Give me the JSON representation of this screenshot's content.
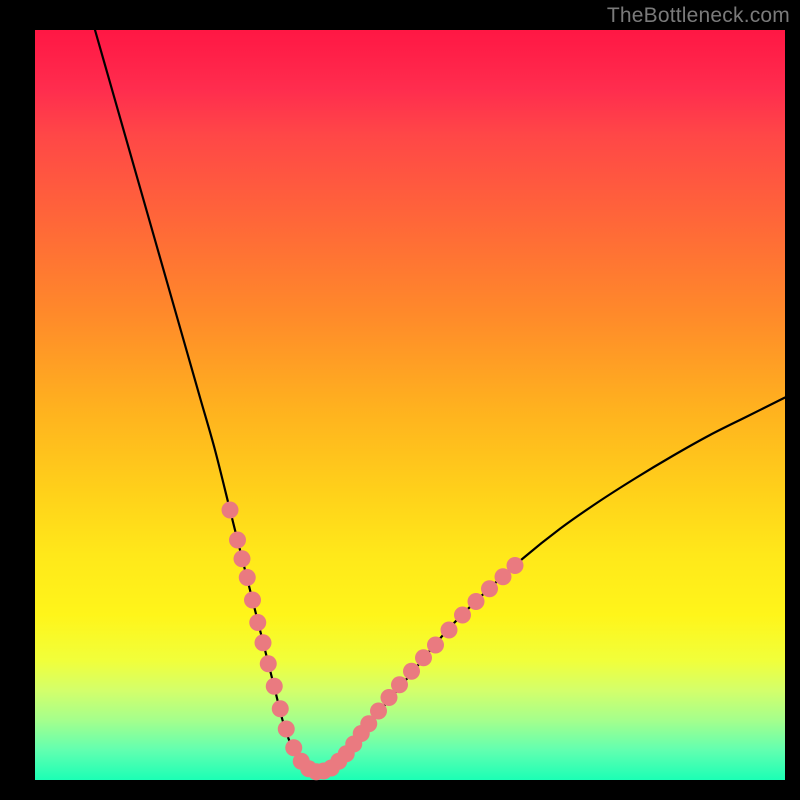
{
  "watermark": "TheBottleneck.com",
  "colors": {
    "background": "#000000",
    "curve": "#000000",
    "dot_fill": "#ea7a80",
    "dot_stroke": "#c45a60",
    "gradient_top": "#ff1744",
    "gradient_bottom": "#1bffb5"
  },
  "chart_data": {
    "type": "line",
    "title": "",
    "xlabel": "",
    "ylabel": "",
    "xlim": [
      0,
      100
    ],
    "ylim": [
      0,
      100
    ],
    "grid": false,
    "legend": false,
    "annotations": [
      "TheBottleneck.com"
    ],
    "series": [
      {
        "name": "bottleneck-curve",
        "x": [
          8,
          10,
          12,
          14,
          16,
          18,
          20,
          22,
          24,
          26,
          27,
          28,
          29,
          30,
          31,
          32,
          33,
          34,
          35,
          36,
          37,
          38,
          39,
          40,
          42,
          45,
          50,
          55,
          60,
          65,
          70,
          75,
          80,
          85,
          90,
          95,
          100
        ],
        "y": [
          100,
          93,
          86,
          79,
          72,
          65,
          58,
          51,
          44,
          36,
          32,
          28,
          24,
          20,
          16,
          12,
          8,
          5,
          3,
          2,
          1.2,
          1,
          1.3,
          2,
          4,
          8,
          14,
          20,
          25,
          29.5,
          33.5,
          37,
          40.2,
          43.2,
          46,
          48.5,
          51
        ]
      }
    ],
    "markers": [
      {
        "x": 26.0,
        "y": 36.0
      },
      {
        "x": 27.0,
        "y": 32.0
      },
      {
        "x": 27.6,
        "y": 29.5
      },
      {
        "x": 28.3,
        "y": 27.0
      },
      {
        "x": 29.0,
        "y": 24.0
      },
      {
        "x": 29.7,
        "y": 21.0
      },
      {
        "x": 30.4,
        "y": 18.3
      },
      {
        "x": 31.1,
        "y": 15.5
      },
      {
        "x": 31.9,
        "y": 12.5
      },
      {
        "x": 32.7,
        "y": 9.5
      },
      {
        "x": 33.5,
        "y": 6.8
      },
      {
        "x": 34.5,
        "y": 4.3
      },
      {
        "x": 35.5,
        "y": 2.5
      },
      {
        "x": 36.5,
        "y": 1.5
      },
      {
        "x": 37.5,
        "y": 1.1
      },
      {
        "x": 38.5,
        "y": 1.2
      },
      {
        "x": 39.5,
        "y": 1.6
      },
      {
        "x": 40.5,
        "y": 2.5
      },
      {
        "x": 41.5,
        "y": 3.5
      },
      {
        "x": 42.5,
        "y": 4.8
      },
      {
        "x": 43.5,
        "y": 6.2
      },
      {
        "x": 44.5,
        "y": 7.5
      },
      {
        "x": 45.8,
        "y": 9.2
      },
      {
        "x": 47.2,
        "y": 11.0
      },
      {
        "x": 48.6,
        "y": 12.7
      },
      {
        "x": 50.2,
        "y": 14.5
      },
      {
        "x": 51.8,
        "y": 16.3
      },
      {
        "x": 53.4,
        "y": 18.0
      },
      {
        "x": 55.2,
        "y": 20.0
      },
      {
        "x": 57.0,
        "y": 22.0
      },
      {
        "x": 58.8,
        "y": 23.8
      },
      {
        "x": 60.6,
        "y": 25.5
      },
      {
        "x": 62.4,
        "y": 27.1
      },
      {
        "x": 64.0,
        "y": 28.6
      }
    ]
  }
}
